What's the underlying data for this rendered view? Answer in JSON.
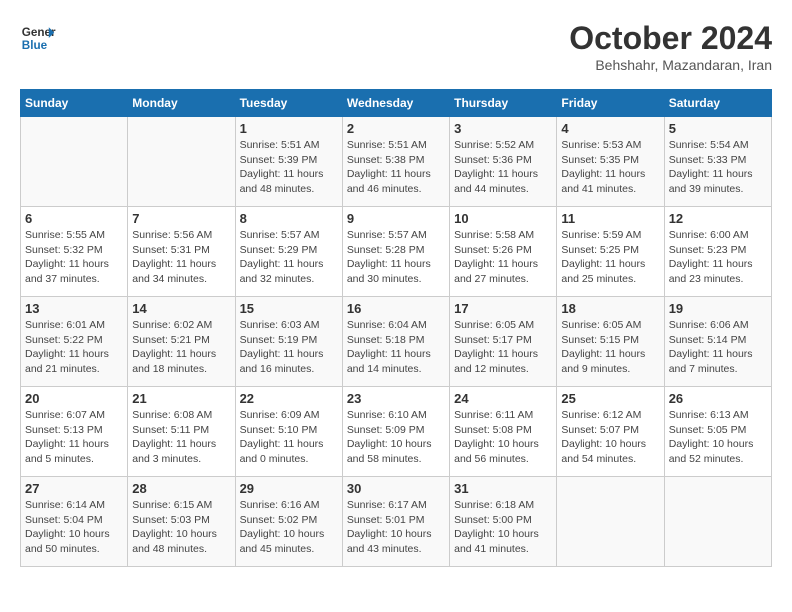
{
  "header": {
    "logo_line1": "General",
    "logo_line2": "Blue",
    "month_year": "October 2024",
    "subtitle": "Behshahr, Mazandaran, Iran"
  },
  "weekdays": [
    "Sunday",
    "Monday",
    "Tuesday",
    "Wednesday",
    "Thursday",
    "Friday",
    "Saturday"
  ],
  "weeks": [
    [
      null,
      null,
      {
        "day": "1",
        "sunrise": "5:51 AM",
        "sunset": "5:39 PM",
        "daylight": "11 hours and 48 minutes."
      },
      {
        "day": "2",
        "sunrise": "5:51 AM",
        "sunset": "5:38 PM",
        "daylight": "11 hours and 46 minutes."
      },
      {
        "day": "3",
        "sunrise": "5:52 AM",
        "sunset": "5:36 PM",
        "daylight": "11 hours and 44 minutes."
      },
      {
        "day": "4",
        "sunrise": "5:53 AM",
        "sunset": "5:35 PM",
        "daylight": "11 hours and 41 minutes."
      },
      {
        "day": "5",
        "sunrise": "5:54 AM",
        "sunset": "5:33 PM",
        "daylight": "11 hours and 39 minutes."
      }
    ],
    [
      {
        "day": "6",
        "sunrise": "5:55 AM",
        "sunset": "5:32 PM",
        "daylight": "11 hours and 37 minutes."
      },
      {
        "day": "7",
        "sunrise": "5:56 AM",
        "sunset": "5:31 PM",
        "daylight": "11 hours and 34 minutes."
      },
      {
        "day": "8",
        "sunrise": "5:57 AM",
        "sunset": "5:29 PM",
        "daylight": "11 hours and 32 minutes."
      },
      {
        "day": "9",
        "sunrise": "5:57 AM",
        "sunset": "5:28 PM",
        "daylight": "11 hours and 30 minutes."
      },
      {
        "day": "10",
        "sunrise": "5:58 AM",
        "sunset": "5:26 PM",
        "daylight": "11 hours and 27 minutes."
      },
      {
        "day": "11",
        "sunrise": "5:59 AM",
        "sunset": "5:25 PM",
        "daylight": "11 hours and 25 minutes."
      },
      {
        "day": "12",
        "sunrise": "6:00 AM",
        "sunset": "5:23 PM",
        "daylight": "11 hours and 23 minutes."
      }
    ],
    [
      {
        "day": "13",
        "sunrise": "6:01 AM",
        "sunset": "5:22 PM",
        "daylight": "11 hours and 21 minutes."
      },
      {
        "day": "14",
        "sunrise": "6:02 AM",
        "sunset": "5:21 PM",
        "daylight": "11 hours and 18 minutes."
      },
      {
        "day": "15",
        "sunrise": "6:03 AM",
        "sunset": "5:19 PM",
        "daylight": "11 hours and 16 minutes."
      },
      {
        "day": "16",
        "sunrise": "6:04 AM",
        "sunset": "5:18 PM",
        "daylight": "11 hours and 14 minutes."
      },
      {
        "day": "17",
        "sunrise": "6:05 AM",
        "sunset": "5:17 PM",
        "daylight": "11 hours and 12 minutes."
      },
      {
        "day": "18",
        "sunrise": "6:05 AM",
        "sunset": "5:15 PM",
        "daylight": "11 hours and 9 minutes."
      },
      {
        "day": "19",
        "sunrise": "6:06 AM",
        "sunset": "5:14 PM",
        "daylight": "11 hours and 7 minutes."
      }
    ],
    [
      {
        "day": "20",
        "sunrise": "6:07 AM",
        "sunset": "5:13 PM",
        "daylight": "11 hours and 5 minutes."
      },
      {
        "day": "21",
        "sunrise": "6:08 AM",
        "sunset": "5:11 PM",
        "daylight": "11 hours and 3 minutes."
      },
      {
        "day": "22",
        "sunrise": "6:09 AM",
        "sunset": "5:10 PM",
        "daylight": "11 hours and 0 minutes."
      },
      {
        "day": "23",
        "sunrise": "6:10 AM",
        "sunset": "5:09 PM",
        "daylight": "10 hours and 58 minutes."
      },
      {
        "day": "24",
        "sunrise": "6:11 AM",
        "sunset": "5:08 PM",
        "daylight": "10 hours and 56 minutes."
      },
      {
        "day": "25",
        "sunrise": "6:12 AM",
        "sunset": "5:07 PM",
        "daylight": "10 hours and 54 minutes."
      },
      {
        "day": "26",
        "sunrise": "6:13 AM",
        "sunset": "5:05 PM",
        "daylight": "10 hours and 52 minutes."
      }
    ],
    [
      {
        "day": "27",
        "sunrise": "6:14 AM",
        "sunset": "5:04 PM",
        "daylight": "10 hours and 50 minutes."
      },
      {
        "day": "28",
        "sunrise": "6:15 AM",
        "sunset": "5:03 PM",
        "daylight": "10 hours and 48 minutes."
      },
      {
        "day": "29",
        "sunrise": "6:16 AM",
        "sunset": "5:02 PM",
        "daylight": "10 hours and 45 minutes."
      },
      {
        "day": "30",
        "sunrise": "6:17 AM",
        "sunset": "5:01 PM",
        "daylight": "10 hours and 43 minutes."
      },
      {
        "day": "31",
        "sunrise": "6:18 AM",
        "sunset": "5:00 PM",
        "daylight": "10 hours and 41 minutes."
      },
      null,
      null
    ]
  ]
}
